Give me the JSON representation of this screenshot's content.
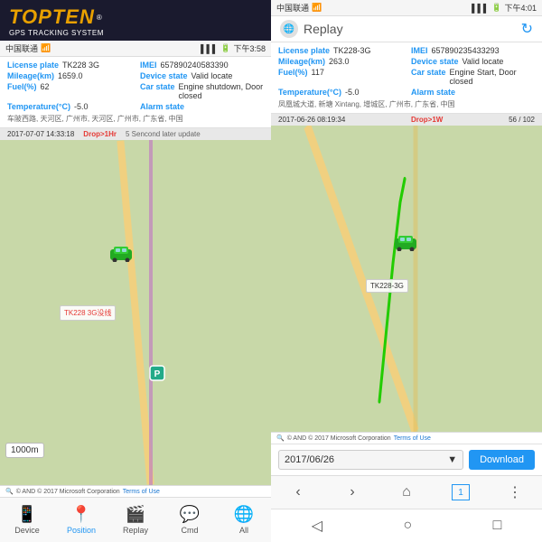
{
  "left_phone": {
    "logo_text": "TOPTEN",
    "logo_reg": "®",
    "subtitle": "GPS TRACKING SYSTEM",
    "status_bar": {
      "carrier": "中国联通",
      "wifi_icon": "WiFi",
      "signal": "▌▌▌",
      "battery": "🔋",
      "time": "下午3:58"
    },
    "device_info": {
      "license_plate_label": "License plate",
      "license_plate_value": "TK228 3G",
      "imei_label": "IMEI",
      "imei_value": "657890240583390",
      "mileage_label": "Mileage(km)",
      "mileage_value": "1659.0",
      "device_state_label": "Device state",
      "device_state_value": "Valid locate",
      "fuel_label": "Fuel(%)",
      "fuel_value": "62",
      "car_state_label": "Car state",
      "car_state_value": "Engine shutdown, Door closed",
      "temp_label": "Temperature(°C)",
      "temp_value": "-5.0",
      "alarm_label": "Alarm state",
      "alarm_value": ""
    },
    "address": "车陂西路, 天河区, 广州市, 天河区, 广州市, 广东省, 中国",
    "map_bar": {
      "datetime": "2017-07-07 14:33:18",
      "drop": "Drop>1Hr",
      "update": "5 Sencond later update"
    },
    "car_label": "TK228 3G没线",
    "zoom_level": "1000m",
    "copyright": "© AND © 2017 Microsoft Corporation",
    "terms": "Terms of Use",
    "nav": {
      "device": "Device",
      "position": "Position",
      "replay": "Replay",
      "cmd": "Cmd",
      "all": "All"
    }
  },
  "right_phone": {
    "status_bar": {
      "carrier": "中国联通",
      "signal": "▌▌▌",
      "battery": "🔋",
      "time": "下午4:01"
    },
    "replay_title": "Replay",
    "device_info": {
      "license_plate_label": "License plate",
      "license_plate_value": "TK228-3G",
      "imei_label": "IMEI",
      "imei_value": "657890235433293",
      "mileage_label": "Mileage(km)",
      "mileage_value": "263.0",
      "device_state_label": "Device state",
      "device_state_value": "Valid locate",
      "fuel_label": "Fuel(%)",
      "fuel_value": "117",
      "car_state_label": "Car state",
      "car_state_value": "Engine Start, Door closed",
      "temp_label": "Temperature(°C)",
      "temp_value": "-5.0",
      "alarm_label": "Alarm state",
      "alarm_value": ""
    },
    "address": "凤凰城大道, 新塘 Xintang, 增城区, 广州市, 广东省, 中国",
    "map_bar": {
      "datetime": "2017-06-26 08:19:34",
      "drop": "Drop>1W",
      "page": "56 / 102"
    },
    "car_label": "TK228-3G",
    "copyright": "© AND © 2017 Microsoft Corporation",
    "terms": "Terms of Use",
    "date_value": "2017/06/26",
    "download_label": "Download",
    "nav": {
      "back": "‹",
      "forward": "›",
      "home": "⌂",
      "page_num": "1",
      "more": "⋮"
    }
  }
}
